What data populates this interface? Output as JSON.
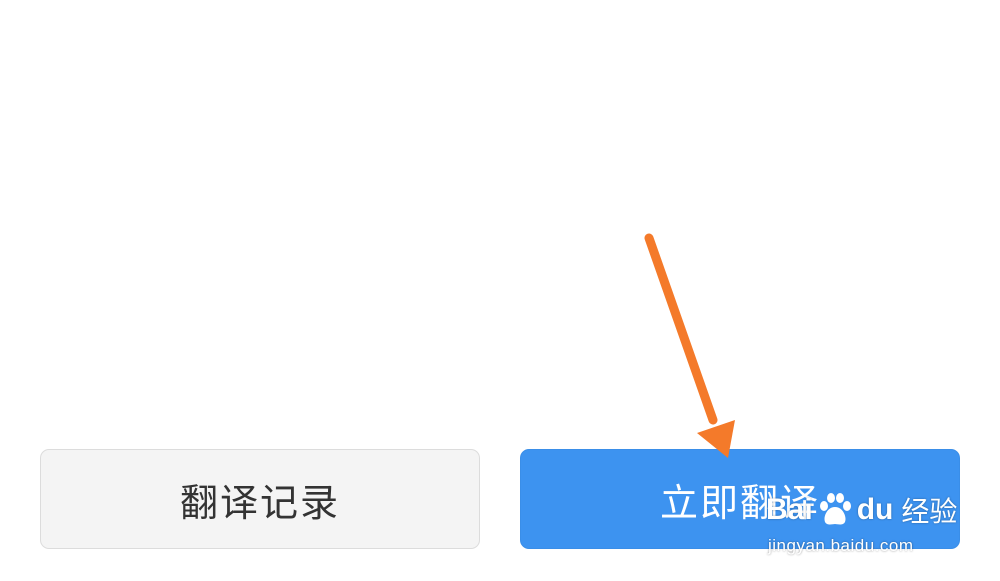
{
  "actions": {
    "history_label": "翻译记录",
    "translate_label": "立即翻译"
  },
  "colors": {
    "primary": "#3d93f0",
    "secondary_bg": "#f4f4f4",
    "arrow": "#f47a2a"
  },
  "watermark": {
    "brand_left": "Bai",
    "brand_right": "du",
    "brand_cn": "经验",
    "url": "jingyan.baidu.com"
  }
}
